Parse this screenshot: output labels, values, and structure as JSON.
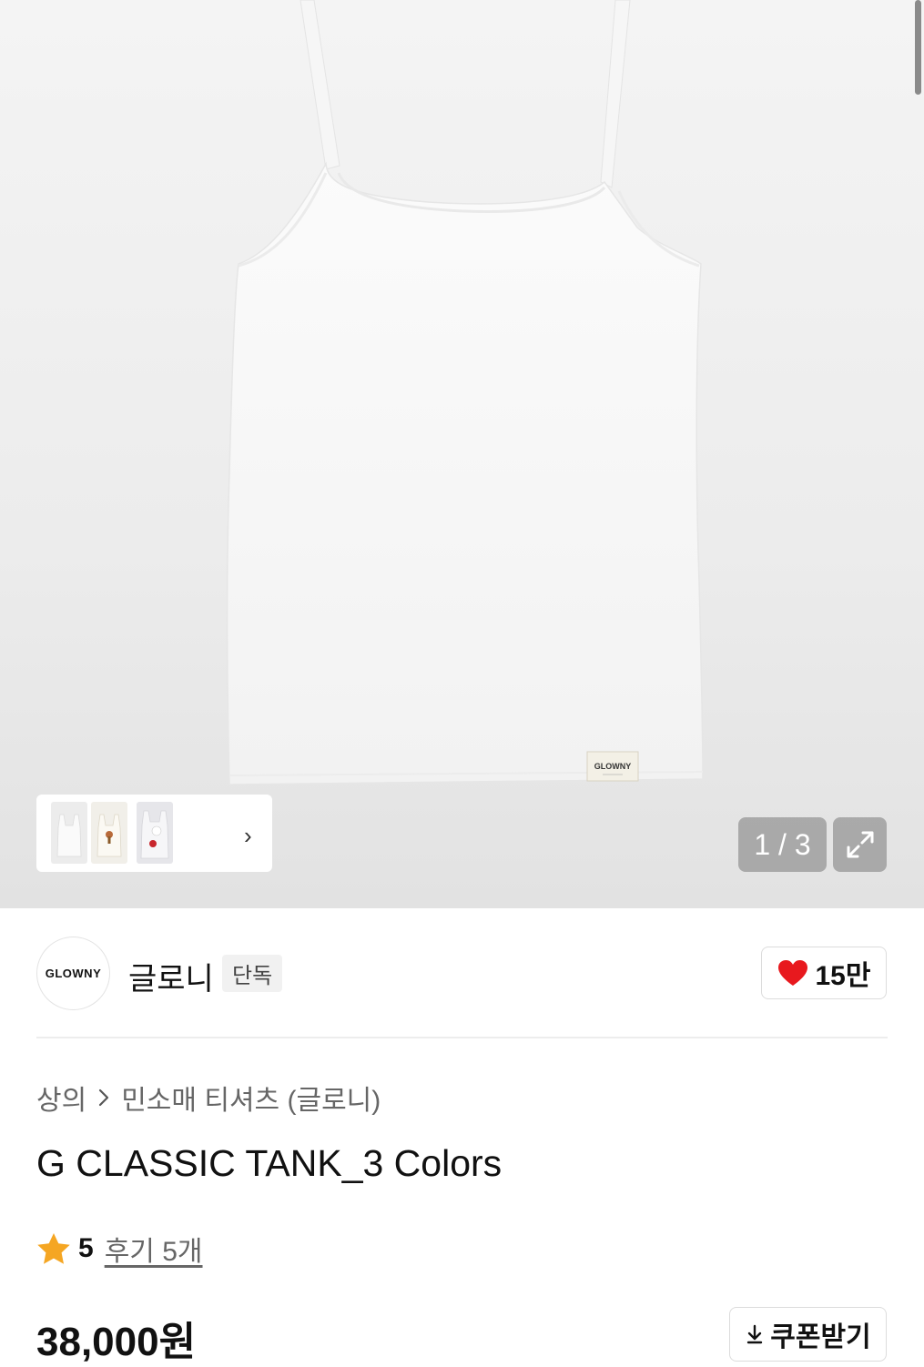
{
  "gallery": {
    "counter": "1 / 3",
    "product_label_text": "GLOWNY",
    "thumbnails": [
      {
        "name": "white-tank"
      },
      {
        "name": "graphic-tank"
      },
      {
        "name": "printed-tank"
      }
    ]
  },
  "brand": {
    "logo_text": "GLOWNY",
    "name": "글로니",
    "exclusive_badge": "단독",
    "likes": "15만"
  },
  "breadcrumb": {
    "category": "상의",
    "subcategory": "민소매 티셔츠 (글로니)"
  },
  "product": {
    "title": "G CLASSIC TANK_3 Colors",
    "rating": "5",
    "reviews": "후기 5개",
    "price": "38,000원"
  },
  "actions": {
    "coupon_label": "쿠폰받기"
  },
  "colors": {
    "heart": "#e8191e",
    "star": "#f5a623",
    "overlay": "#969696"
  }
}
